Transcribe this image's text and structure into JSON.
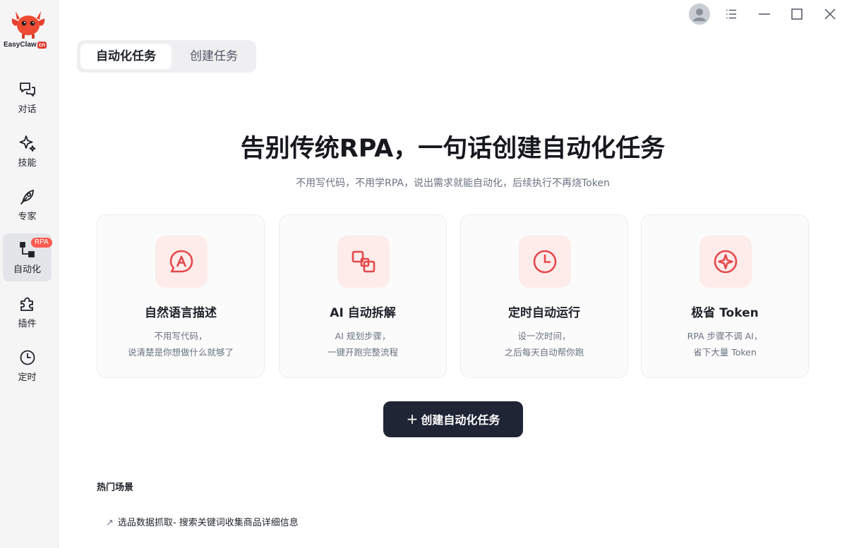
{
  "app": {
    "logo_text": "EasyClaw",
    "logo_badge": "cn"
  },
  "sidebar": {
    "items": [
      {
        "label": "对话",
        "icon": "chat-icon"
      },
      {
        "label": "技能",
        "icon": "sparkle-icon"
      },
      {
        "label": "专家",
        "icon": "feather-icon"
      },
      {
        "label": "自动化",
        "icon": "flow-icon",
        "badge": "RPA",
        "active": true
      },
      {
        "label": "插件",
        "icon": "puzzle-icon"
      },
      {
        "label": "定时",
        "icon": "clock-icon"
      }
    ]
  },
  "window": {
    "controls": [
      "avatar",
      "menu-icon",
      "minimize-icon",
      "maximize-icon",
      "close-icon"
    ]
  },
  "tabs": [
    {
      "label": "自动化任务",
      "active": true
    },
    {
      "label": "创建任务",
      "active": false
    }
  ],
  "hero": {
    "title": "告别传统RPA，一句话创建自动化任务",
    "subtitle": "不用写代码，不用学RPA，说出需求就能自动化，后续执行不再烧Token"
  },
  "features": [
    {
      "title": "自然语言描述",
      "desc_line1": "不用写代码，",
      "desc_line2": "说清楚是你想做什么就够了",
      "icon": "chat-a-icon"
    },
    {
      "title": "AI 自动拆解",
      "desc_line1": "AI 规划步骤，",
      "desc_line2": "一键开跑完整流程",
      "icon": "split-icon"
    },
    {
      "title": "定时自动运行",
      "desc_line1": "设一次时间，",
      "desc_line2": "之后每天自动帮你跑",
      "icon": "clock-icon"
    },
    {
      "title": "极省 Token",
      "desc_line1": "RPA 步骤不调 AI，",
      "desc_line2": "省下大量 Token",
      "icon": "token-icon"
    }
  ],
  "cta": {
    "label": "创建自动化任务"
  },
  "hot": {
    "title": "热门场景",
    "items": [
      {
        "label": "选品数据抓取- 搜索关键词收集商品详细信息"
      }
    ]
  },
  "colors": {
    "accent": "#e5484d",
    "icon_bg": "#fdecea",
    "cta_bg": "#1f2535",
    "badge": "#ff5a4e"
  }
}
